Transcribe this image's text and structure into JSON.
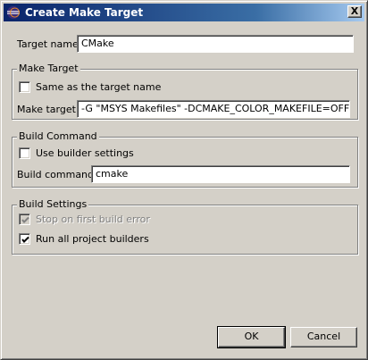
{
  "window": {
    "title": "Create Make Target",
    "close_glyph": "X"
  },
  "target_name": {
    "label": "Target name:",
    "value": "CMake"
  },
  "make_target": {
    "group_title": "Make Target",
    "same_as_name": {
      "label": "Same as the target name",
      "checked": false
    },
    "label": "Make target:",
    "value": "-G \"MSYS Makefiles\" -DCMAKE_COLOR_MAKEFILE=OFF .."
  },
  "build_command": {
    "group_title": "Build Command",
    "use_builder": {
      "label": "Use builder settings",
      "checked": false
    },
    "label": "Build command:",
    "value": "cmake"
  },
  "build_settings": {
    "group_title": "Build Settings",
    "stop_on_error": {
      "label": "Stop on first build error",
      "checked": true,
      "enabled": false
    },
    "run_all": {
      "label": "Run all project builders",
      "checked": true,
      "enabled": true
    }
  },
  "buttons": {
    "ok": "OK",
    "cancel": "Cancel"
  },
  "icons": {
    "app": "eclipse-icon",
    "close": "close-icon",
    "check": "checkmark-icon"
  },
  "colors": {
    "title_start": "#0a246a",
    "title_end": "#a6caf0",
    "face": "#d4d0c8"
  }
}
